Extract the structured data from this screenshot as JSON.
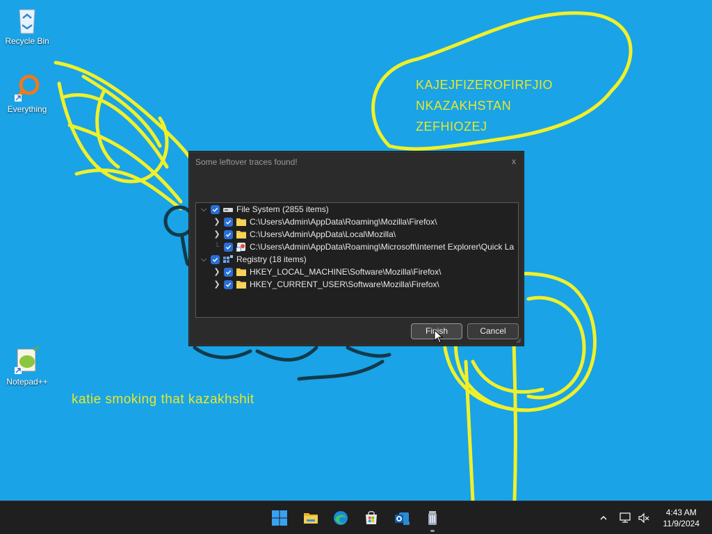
{
  "desktop": {
    "icons": [
      {
        "label": "Recycle Bin"
      },
      {
        "label": "Everything"
      },
      {
        "label": "Notepad++"
      }
    ],
    "scribble_texts": {
      "line1": "KAJEJFIZEROFIRFJIO",
      "line2": "NKAZAKHSTAN",
      "line3": "ZEFHIOZEJ",
      "caption": "katie smoking that kazakhshit"
    },
    "colors": {
      "background": "#1aa3e6",
      "scribble_yellow": "#f0f02a",
      "scribble_dark": "#123a4a"
    }
  },
  "dialog": {
    "title": "Some leftover traces found!",
    "close_label": "x",
    "tree": [
      {
        "label": "File System (2855 items)",
        "checked": true,
        "expanded": true,
        "icon": "drive-icon"
      },
      {
        "label": "C:\\Users\\Admin\\AppData\\Roaming\\Mozilla\\Firefox\\",
        "checked": true,
        "icon": "folder-icon"
      },
      {
        "label": "C:\\Users\\Admin\\AppData\\Local\\Mozilla\\",
        "checked": true,
        "icon": "folder-icon"
      },
      {
        "label": "C:\\Users\\Admin\\AppData\\Roaming\\Microsoft\\Internet Explorer\\Quick La",
        "checked": true,
        "icon": "shortcut-icon"
      },
      {
        "label": "Registry (18 items)",
        "checked": true,
        "expanded": true,
        "icon": "registry-icon"
      },
      {
        "label": "HKEY_LOCAL_MACHINE\\Software\\Mozilla\\Firefox\\",
        "checked": true,
        "icon": "folder-icon"
      },
      {
        "label": "HKEY_CURRENT_USER\\Software\\Mozilla\\Firefox\\",
        "checked": true,
        "icon": "folder-icon"
      }
    ],
    "buttons": {
      "finish": "Finish",
      "cancel": "Cancel"
    }
  },
  "taskbar": {
    "apps": [
      "start-icon",
      "file-explorer-icon",
      "edge-icon",
      "store-icon",
      "outlook-icon",
      "uninstaller-icon"
    ],
    "clock": {
      "time": "4:43 AM",
      "date": "11/9/2024"
    }
  }
}
